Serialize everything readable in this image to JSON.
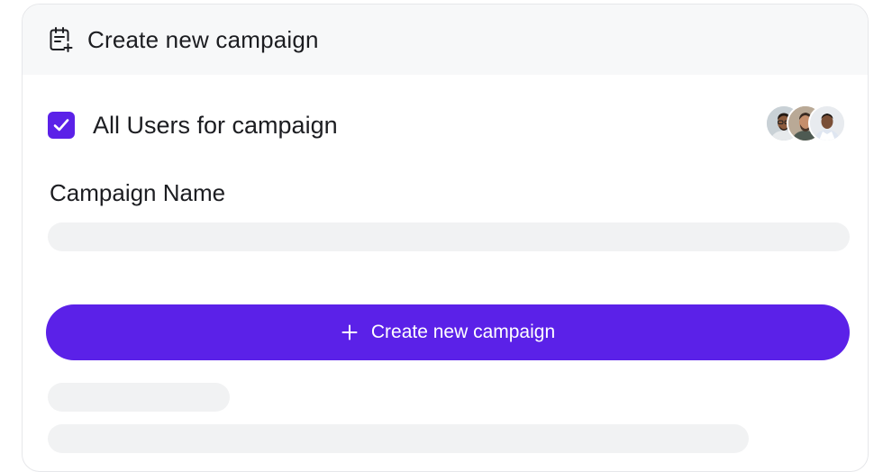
{
  "header": {
    "title": "Create new campaign",
    "icon": "calendar-plus-icon"
  },
  "users": {
    "label": "All Users for campaign",
    "checked": true,
    "avatars": [
      "avatar-1",
      "avatar-2",
      "avatar-3"
    ]
  },
  "form": {
    "campaign_name_label": "Campaign Name",
    "campaign_name_value": "",
    "campaign_name_placeholder": ""
  },
  "actions": {
    "create_label": "Create new campaign",
    "create_icon": "plus-icon"
  },
  "colors": {
    "accent": "#5b21e8",
    "header_bg": "#f7f8f9",
    "skeleton": "#f1f2f3",
    "text": "#1c1d21"
  }
}
